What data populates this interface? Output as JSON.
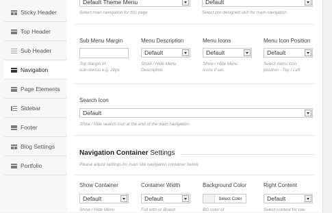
{
  "sidebar": {
    "items": [
      {
        "label": "",
        "icon": "blank-icon"
      },
      {
        "label": "Sticky Header",
        "icon": "grid-icon"
      },
      {
        "label": "Top Header",
        "icon": "bar-icon"
      },
      {
        "label": "Sub Header",
        "icon": "lines-icon"
      },
      {
        "label": "Navigation",
        "icon": "navigation-icon",
        "active": true
      },
      {
        "label": "Page Elements",
        "icon": "bar-icon"
      },
      {
        "label": "Sidebar",
        "icon": "sidebar-icon"
      },
      {
        "label": "Footer",
        "icon": "footer-icon"
      },
      {
        "label": "Blog Settings",
        "icon": "grid-icon"
      },
      {
        "label": "Portfolio",
        "icon": "bar-icon"
      }
    ]
  },
  "top_row": {
    "main_nav": {
      "value": "Default Theme Menu",
      "hint": "Select main navigation for this page"
    },
    "skin": {
      "value": "Default",
      "hint": "Select pre-designed skin for main navigation"
    }
  },
  "submenu_row": {
    "margin": {
      "label": "Sub Menu Margin",
      "value": "",
      "hint1": "Top margin of",
      "hint2": "sub-menus e.g. 20px"
    },
    "description": {
      "label": "Menu Description",
      "value": "Default",
      "hint1": "Show / Hide Menu",
      "hint2": "Description."
    },
    "icons": {
      "label": "Menu Icons",
      "value": "Default",
      "hint1": "Show / Hide Menu",
      "hint2": "Icons if set."
    },
    "icon_position": {
      "label": "Menu Icon Position",
      "value": "Default",
      "hint1": "Select menu icon",
      "hint2": "position - Top / Left"
    }
  },
  "search": {
    "label": "Search Icon",
    "value": "Default",
    "hint": "Show / hide search icon at the end of the main navigation"
  },
  "container_section": {
    "title_bold": "Navigation Container",
    "title_light": " Settings",
    "subtitle": "Please adjust settings for main site navigation container below."
  },
  "container_row": {
    "show": {
      "label": "Show Container",
      "value": "Default",
      "hint": "Show / Hide Menu"
    },
    "width": {
      "label": "Container Width",
      "value": "Default",
      "hint": "Full with or Boxed"
    },
    "bg": {
      "label": "Background Color",
      "button": "Select Color",
      "hint": "BG color of"
    },
    "right": {
      "label": "Right Content",
      "value": "Default",
      "hint": "Select content for nav"
    }
  },
  "colors": {
    "panel_bg": "#ffffff",
    "sidebar_bg": "#f7f7f7",
    "page_bg": "#f1f1f1"
  }
}
